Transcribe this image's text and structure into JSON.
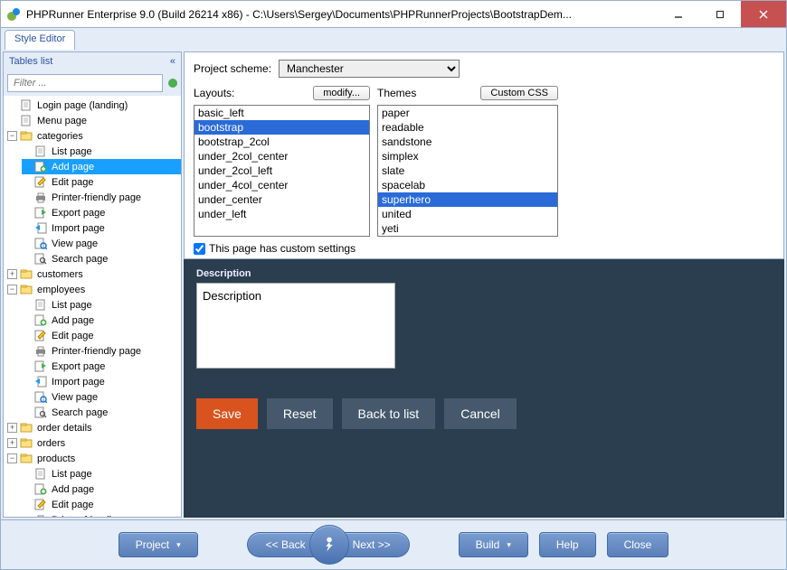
{
  "title": "PHPRunner Enterprise 9.0 (Build 26214 x86) - C:\\Users\\Sergey\\Documents\\PHPRunnerProjects\\BootstrapDem...",
  "tab": "Style Editor",
  "sidebar": {
    "header": "Tables list",
    "filter_placeholder": "Filter ...",
    "tree": [
      {
        "label": "Login page (landing)",
        "leaf": true,
        "icon": "page"
      },
      {
        "label": "Menu page",
        "leaf": true,
        "icon": "page"
      },
      {
        "label": "categories",
        "expanded": true,
        "icon": "folder",
        "children": [
          {
            "label": "List page",
            "icon": "page"
          },
          {
            "label": "Add page",
            "icon": "add",
            "selected": true
          },
          {
            "label": "Edit page",
            "icon": "edit"
          },
          {
            "label": "Printer-friendly page",
            "icon": "printer"
          },
          {
            "label": "Export page",
            "icon": "export"
          },
          {
            "label": "Import page",
            "icon": "import"
          },
          {
            "label": "View page",
            "icon": "view"
          },
          {
            "label": "Search page",
            "icon": "search"
          }
        ]
      },
      {
        "label": "customers",
        "expanded": false,
        "icon": "folder"
      },
      {
        "label": "employees",
        "expanded": true,
        "icon": "folder",
        "children": [
          {
            "label": "List page",
            "icon": "page"
          },
          {
            "label": "Add page",
            "icon": "add"
          },
          {
            "label": "Edit page",
            "icon": "edit"
          },
          {
            "label": "Printer-friendly page",
            "icon": "printer"
          },
          {
            "label": "Export page",
            "icon": "export"
          },
          {
            "label": "Import page",
            "icon": "import"
          },
          {
            "label": "View page",
            "icon": "view"
          },
          {
            "label": "Search page",
            "icon": "search"
          }
        ]
      },
      {
        "label": "order details",
        "expanded": false,
        "icon": "folder"
      },
      {
        "label": "orders",
        "expanded": false,
        "icon": "folder"
      },
      {
        "label": "products",
        "expanded": true,
        "icon": "folder",
        "children": [
          {
            "label": "List page",
            "icon": "page"
          },
          {
            "label": "Add page",
            "icon": "add"
          },
          {
            "label": "Edit page",
            "icon": "edit"
          },
          {
            "label": "Printer-friendly page",
            "icon": "printer"
          }
        ]
      }
    ]
  },
  "scheme": {
    "label": "Project scheme:",
    "value": "Manchester",
    "layouts_label": "Layouts:",
    "modify_btn": "modify...",
    "themes_label": "Themes",
    "custom_css_btn": "Custom CSS",
    "layouts": [
      "basic_left",
      "bootstrap",
      "bootstrap_2col",
      "under_2col_center",
      "under_2col_left",
      "under_4col_center",
      "under_center",
      "under_left"
    ],
    "layouts_selected": "bootstrap",
    "themes": [
      "paper",
      "readable",
      "sandstone",
      "simplex",
      "slate",
      "spacelab",
      "superhero",
      "united",
      "yeti"
    ],
    "themes_selected": "superhero",
    "custom_settings_label": "This page has custom settings",
    "custom_settings_checked": true
  },
  "preview": {
    "desc_label": "Description",
    "desc_value": "Description",
    "save": "Save",
    "reset": "Reset",
    "back": "Back to list",
    "cancel": "Cancel"
  },
  "bottom": {
    "project": "Project",
    "back": "<<  Back",
    "next": "Next  >>",
    "build": "Build",
    "help": "Help",
    "close": "Close"
  }
}
